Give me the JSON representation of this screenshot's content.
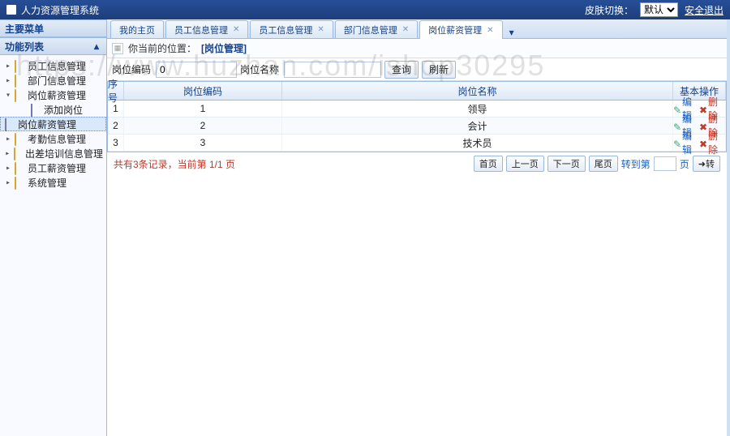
{
  "header": {
    "title": "人力资源管理系统",
    "skin_label": "皮肤切换：",
    "skin_options": [
      "默认"
    ],
    "skin_selected": "默认",
    "logout": "安全退出"
  },
  "sidebar": {
    "group1": "主要菜单",
    "group2": "功能列表",
    "nodes": [
      {
        "label": "员工信息管理",
        "expanded": false
      },
      {
        "label": "部门信息管理",
        "expanded": false
      },
      {
        "label": "岗位薪资管理",
        "expanded": true,
        "children": [
          {
            "label": "添加岗位"
          },
          {
            "label": "岗位薪资管理",
            "selected": true
          }
        ]
      },
      {
        "label": "考勤信息管理",
        "expanded": false
      },
      {
        "label": "出差培训信息管理",
        "expanded": false
      },
      {
        "label": "员工薪资管理",
        "expanded": false
      },
      {
        "label": "系统管理",
        "expanded": false
      }
    ]
  },
  "tabs": {
    "items": [
      {
        "label": "我的主页",
        "closable": false,
        "active": false
      },
      {
        "label": "员工信息管理",
        "closable": true,
        "active": false
      },
      {
        "label": "员工信息管理",
        "closable": true,
        "active": false
      },
      {
        "label": "部门信息管理",
        "closable": true,
        "active": false
      },
      {
        "label": "岗位薪资管理",
        "closable": true,
        "active": true
      }
    ]
  },
  "location": {
    "prefix": "你当前的位置：",
    "crumb": "[岗位管理]"
  },
  "filter": {
    "code_label": "岗位编码",
    "code_value": "0",
    "name_label": "岗位名称",
    "name_value": "",
    "search": "查询",
    "refresh": "刷新"
  },
  "grid": {
    "headers": {
      "seq": "序号",
      "code": "岗位编码",
      "name": "岗位名称",
      "op": "基本操作"
    },
    "rows": [
      {
        "seq": "1",
        "code": "1",
        "name": "领导"
      },
      {
        "seq": "2",
        "code": "2",
        "name": "会计"
      },
      {
        "seq": "3",
        "code": "3",
        "name": "技术员"
      }
    ],
    "op_edit": "编辑",
    "op_del": "删除"
  },
  "pager": {
    "summary": "共有3条记录，当前第 1/1 页",
    "first": "首页",
    "prev": "上一页",
    "next": "下一页",
    "last": "尾页",
    "goto_label": "转到第",
    "goto_suffix": "页",
    "goto_btn": "➜转"
  },
  "watermark": "https://www.huzhan.com/ishop30295"
}
